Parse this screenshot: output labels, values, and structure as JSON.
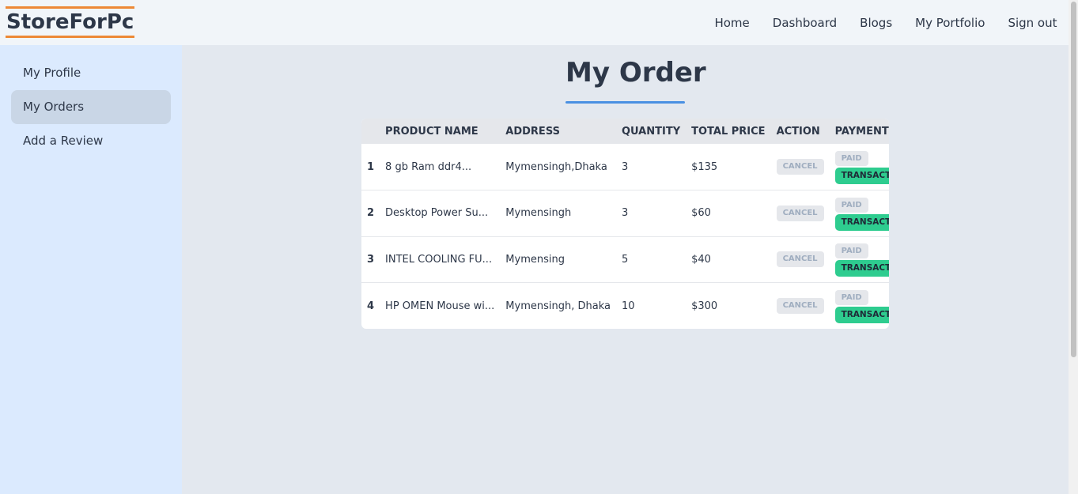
{
  "brand": "StoreForPc",
  "nav": [
    "Home",
    "Dashboard",
    "Blogs",
    "My Portfolio",
    "Sign out"
  ],
  "sidebar": {
    "items": [
      {
        "label": "My Profile"
      },
      {
        "label": "My Orders"
      },
      {
        "label": "Add a Review"
      }
    ]
  },
  "page_title": "My Order",
  "table": {
    "headers": [
      "",
      "PRODUCT NAME",
      "ADDRESS",
      "QUANTITY",
      "TOTAL PRICE",
      "ACTION",
      "PAYMENT STATUS"
    ],
    "rows": [
      {
        "num": "1",
        "product": "8 gb Ram ddr4...",
        "address": "Mymensingh,Dhaka",
        "quantity": "3",
        "price": "$135",
        "action": "CANCEL",
        "paid": "PAID",
        "txn": "TRANSACTIONID"
      },
      {
        "num": "2",
        "product": "Desktop Power Su...",
        "address": "Mymensingh",
        "quantity": "3",
        "price": "$60",
        "action": "CANCEL",
        "paid": "PAID",
        "txn": "TRANSACTIONID"
      },
      {
        "num": "3",
        "product": "INTEL COOLING FU...",
        "address": "Mymensing",
        "quantity": "5",
        "price": "$40",
        "action": "CANCEL",
        "paid": "PAID",
        "txn": "TRANSACTIONID"
      },
      {
        "num": "4",
        "product": "HP OMEN Mouse wi...",
        "address": "Mymensingh, Dhaka",
        "quantity": "10",
        "price": "$300",
        "action": "CANCEL",
        "paid": "PAID",
        "txn": "TRANSACTIONID"
      }
    ]
  },
  "colors": {
    "brand_underline": "#ed8936",
    "title_underline": "#4a90e2",
    "transaction_badge": "#2ecc8f",
    "sidebar_bg": "#dbeafe"
  }
}
